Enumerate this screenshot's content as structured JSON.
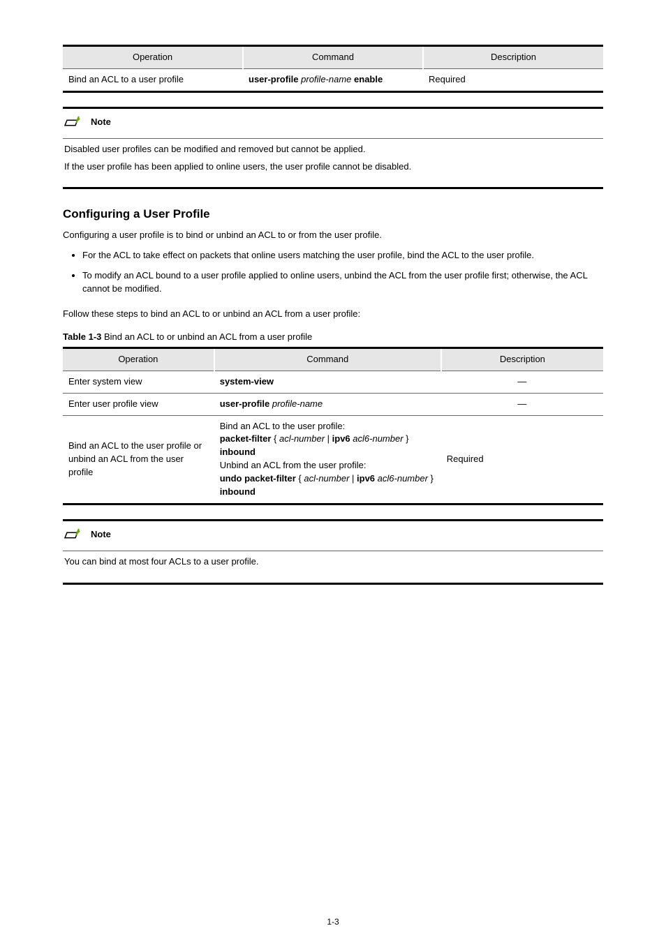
{
  "table1": {
    "headers": [
      "Operation",
      "Command",
      "Description"
    ],
    "row": {
      "operation": "Bind an ACL to a user profile",
      "command_html": "<span class='cmd'>user-profile</span> <span class='param'>profile-name</span> <span class='cmd'>enable</span>",
      "description": "Required"
    }
  },
  "note1": {
    "label": "Note",
    "lines": [
      "Disabled user profiles can be modified and removed but cannot be applied.",
      "If the user profile has been applied to online users, the user profile cannot be disabled."
    ]
  },
  "section2": {
    "title": "Configuring a User Profile",
    "intro": "Configuring a user profile is to bind or unbind an ACL to or from the user profile.",
    "bullets": [
      "For the ACL to take effect on packets that online users matching the user profile, bind the ACL to the user profile.",
      "To modify an ACL bound to a user profile applied to online users, unbind the ACL from the user profile first; otherwise, the ACL cannot be modified."
    ],
    "para": "Follow these steps to bind an ACL to or unbind an ACL from a user profile:",
    "caption_html": "<span class='cmd'>Table 1-3</span> Bind an ACL to or unbind an ACL from a user profile"
  },
  "table2": {
    "headers": [
      "Operation",
      "Command",
      "Description"
    ],
    "rows": [
      {
        "operation": "Enter system view",
        "command_html": "<span class='cmd'>system-view</span>",
        "description": "—"
      },
      {
        "operation": "Enter user profile view",
        "command_html": "<span class='cmd'>user-profile</span> <span class='param'>profile-name</span>",
        "description": "—"
      },
      {
        "operation": "Bind an ACL to the user profile or unbind an ACL from the user profile",
        "command_html": "Bind an ACL to the user profile:<br><span class='cmd'>packet-filter</span> { <span class='param'>acl-number</span> | <span class='cmd'>ipv6</span> <span class='param'>acl6-number</span> } <span class='cmd'>inbound</span><br>Unbind an ACL from the user profile:<br><span class='cmd'>undo packet-filter</span> { <span class='param'>acl-number</span> | <span class='cmd'>ipv6</span> <span class='param'>acl6-number</span> } <span class='cmd'>inbound</span>",
        "description": "Required"
      }
    ]
  },
  "note2": {
    "label": "Note",
    "lines": [
      "You can bind at most four ACLs to a user profile."
    ]
  },
  "page_number": "1-3"
}
